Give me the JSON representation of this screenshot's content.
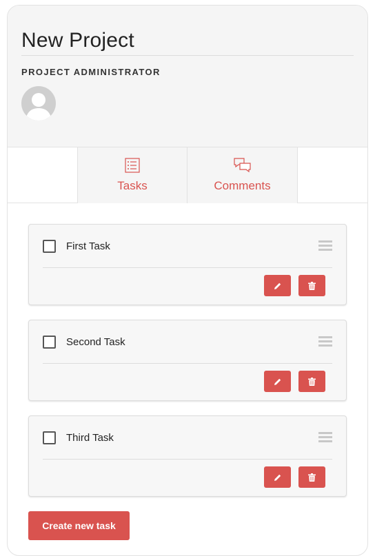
{
  "project": {
    "title": "New Project",
    "role_label": "PROJECT ADMINISTRATOR"
  },
  "tabs": [
    {
      "label": "Tasks",
      "icon": "list-icon"
    },
    {
      "label": "Comments",
      "icon": "comments-icon"
    }
  ],
  "tasks": [
    {
      "name": "First Task",
      "checked": false
    },
    {
      "name": "Second Task",
      "checked": false
    },
    {
      "name": "Third Task",
      "checked": false
    }
  ],
  "actions": {
    "create_task_label": "Create new task"
  },
  "colors": {
    "accent": "#d9534f",
    "header_bg": "#f5f5f5",
    "card_bg": "#f7f7f7"
  }
}
